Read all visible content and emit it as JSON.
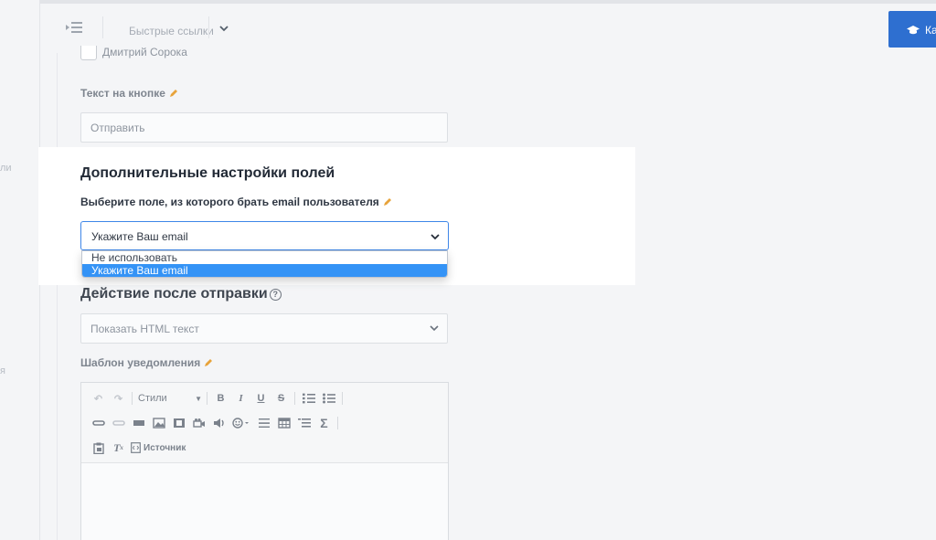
{
  "topbar": {
    "quick_links_label": "Быстрые ссылки",
    "primary_button_label": "Ка"
  },
  "left_rail": {
    "fragment_1": "ли",
    "fragment_2": "я"
  },
  "form": {
    "recipient_name": "Дмитрий Сорока",
    "button_text_label": "Текст на кнопке",
    "button_text_value": "Отправить",
    "extra_settings_title": "Дополнительные настройки полей",
    "email_field_label": "Выберите поле, из которого брать email пользователя",
    "email_field_value": "Укажите Ваш email",
    "email_field_options": [
      "Не использовать",
      "Укажите Ваш email"
    ],
    "email_field_selected_index": 1,
    "after_submit_title": "Действие после отправки",
    "after_submit_value": "Показать HTML текст",
    "template_label": "Шаблон уведомления"
  },
  "editor": {
    "styles_label": "Стили",
    "source_label": "Источник"
  },
  "colors": {
    "accent": "#2e6fd0",
    "select_focus": "#3e86e8",
    "option_highlight": "#3493f6",
    "pencil": "#e7a33b"
  }
}
